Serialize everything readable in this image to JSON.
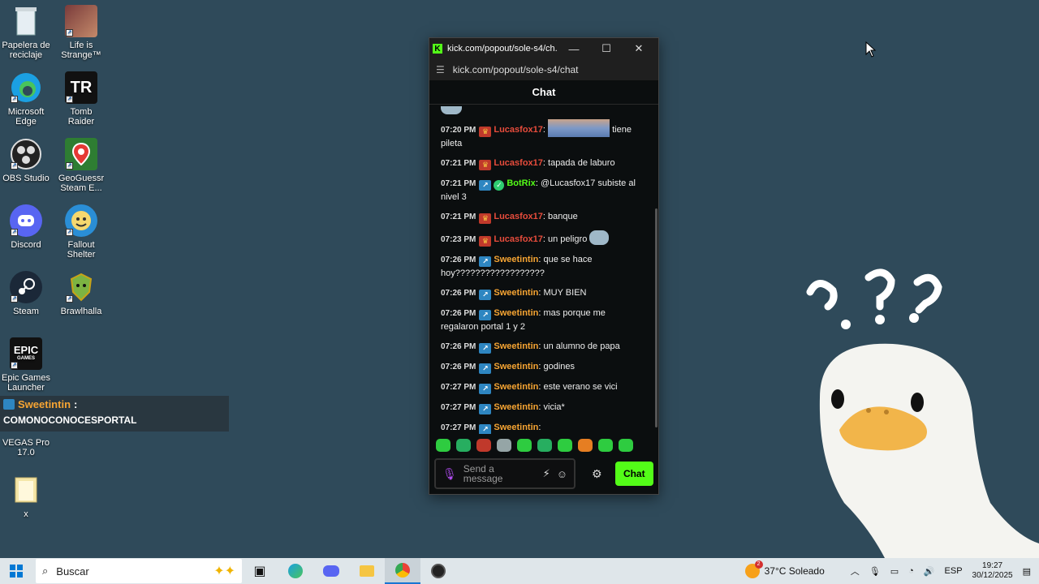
{
  "desktop": {
    "icons": [
      {
        "label": "Papelera de reciclaje"
      },
      {
        "label": "Life is Strange™"
      },
      {
        "label": "Microsoft Edge"
      },
      {
        "label": "Tomb Raider"
      },
      {
        "label": "OBS Studio"
      },
      {
        "label": "GeoGuessr Steam E..."
      },
      {
        "label": "Discord"
      },
      {
        "label": "Fallout Shelter"
      },
      {
        "label": "Steam"
      },
      {
        "label": "Brawlhalla"
      },
      {
        "label": "Epic Games Launcher"
      },
      {
        "label": "VEGAS Pro 17.0"
      },
      {
        "label": "x"
      }
    ],
    "tomb_raider_logo": "TR",
    "epic_logo": "EPIC",
    "epic_logo_sub": "GAMES"
  },
  "overlay": {
    "username": "Sweetintin",
    "separator": ":",
    "message": "COMONOCONOCESPORTAL"
  },
  "window": {
    "title": "kick.com/popout/sole-s4/ch...",
    "url": "kick.com/popout/sole-s4/chat",
    "minimize": "—",
    "maximize": "☐",
    "close": "✕"
  },
  "chat": {
    "header": "Chat",
    "placeholder": "Send a message",
    "send_label": "Chat",
    "messages": [
      {
        "time": "07:20 PM",
        "user": "Lucasfox17",
        "text": "tiene pileta",
        "badge": "red",
        "color": "#e74c3c",
        "emote": true
      },
      {
        "time": "07:21 PM",
        "user": "Lucasfox17",
        "text": "tapada de laburo",
        "badge": "red",
        "color": "#e74c3c"
      },
      {
        "time": "07:21 PM",
        "user": "BotRix",
        "text": "@Lucasfox17 subiste al nivel 3",
        "badge": "blue",
        "color": "#53fc18",
        "verified": true
      },
      {
        "time": "07:21 PM",
        "user": "Lucasfox17",
        "text": "banque",
        "badge": "red",
        "color": "#e74c3c"
      },
      {
        "time": "07:23 PM",
        "user": "Lucasfox17",
        "text": "un peligro",
        "badge": "red",
        "color": "#e74c3c",
        "small_emote": true
      },
      {
        "time": "07:26 PM",
        "user": "Sweetintin",
        "text": "que se hace hoy??????????????????",
        "badge": "blue",
        "color": "#f7a533"
      },
      {
        "time": "07:26 PM",
        "user": "Sweetintin",
        "text": "MUY BIEN",
        "badge": "blue",
        "color": "#f7a533"
      },
      {
        "time": "07:26 PM",
        "user": "Sweetintin",
        "text": "mas porque me regalaron portal 1 y 2",
        "badge": "blue",
        "color": "#f7a533"
      },
      {
        "time": "07:26 PM",
        "user": "Sweetintin",
        "text": "un alumno de papa",
        "badge": "blue",
        "color": "#f7a533"
      },
      {
        "time": "07:26 PM",
        "user": "Sweetintin",
        "text": "godines",
        "badge": "blue",
        "color": "#f7a533"
      },
      {
        "time": "07:27 PM",
        "user": "Sweetintin",
        "text": "este verano se vici",
        "badge": "blue",
        "color": "#f7a533"
      },
      {
        "time": "07:27 PM",
        "user": "Sweetintin",
        "text": "vicia*",
        "badge": "blue",
        "color": "#f7a533"
      },
      {
        "time": "07:27 PM",
        "user": "Sweetintin",
        "text": "COMONOCONOCESPORTAL",
        "badge": "blue",
        "color": "#f7a533"
      }
    ],
    "emote_colors": [
      "#2ecc40",
      "#27ae60",
      "#c0392b",
      "#95a5a6",
      "#2ecc40",
      "#27ae60",
      "#2ecc40",
      "#e67e22",
      "#2ecc40",
      "#2ecc40"
    ]
  },
  "taskbar": {
    "search_label": "Buscar",
    "weather": "37°C  Soleado",
    "weather_badge": "2",
    "language": "ESP",
    "time": "19:27",
    "date": "30/12/2025"
  }
}
